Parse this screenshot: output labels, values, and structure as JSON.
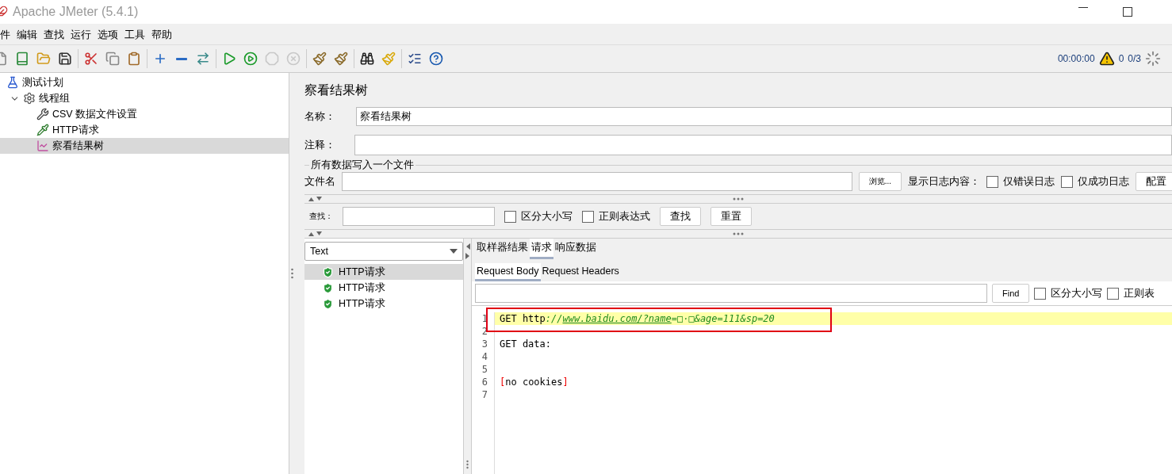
{
  "window": {
    "title": "Apache JMeter (5.4.1)"
  },
  "menu": [
    "件",
    "编辑",
    "查找",
    "运行",
    "选项",
    "工具",
    "帮助"
  ],
  "toolbar": [
    [
      {
        "kind": "new",
        "disabled": false
      },
      {
        "kind": "templates",
        "disabled": false
      },
      {
        "kind": "open",
        "disabled": false
      },
      {
        "kind": "save",
        "disabled": false
      }
    ],
    [
      {
        "kind": "cut",
        "disabled": false
      },
      {
        "kind": "copy",
        "disabled": false
      },
      {
        "kind": "paste",
        "disabled": false
      }
    ],
    [
      {
        "kind": "expand",
        "disabled": false
      },
      {
        "kind": "collapse",
        "disabled": false
      },
      {
        "kind": "toggle",
        "disabled": false
      }
    ],
    [
      {
        "kind": "start",
        "disabled": false
      },
      {
        "kind": "start-no-timers",
        "disabled": false
      },
      {
        "kind": "stop",
        "disabled": true
      },
      {
        "kind": "shutdown",
        "disabled": true
      }
    ],
    [
      {
        "kind": "clear",
        "disabled": false
      },
      {
        "kind": "clear-all",
        "disabled": false
      }
    ],
    [
      {
        "kind": "search",
        "disabled": false
      },
      {
        "kind": "reset-search",
        "disabled": false
      }
    ],
    [
      {
        "kind": "functions",
        "disabled": false
      },
      {
        "kind": "help",
        "disabled": false
      }
    ]
  ],
  "status": {
    "timer": "00:00:00",
    "warnings": "0",
    "threads": "0/3"
  },
  "tree": [
    {
      "label": "测试计划",
      "kind": "plan",
      "selected": false,
      "children": [
        {
          "label": "线程组",
          "kind": "thread-group",
          "selected": false,
          "expanded": true,
          "children": [
            {
              "label": "CSV 数据文件设置",
              "kind": "config",
              "selected": false
            },
            {
              "label": "HTTP请求",
              "kind": "sampler",
              "selected": false
            },
            {
              "label": "察看结果树",
              "kind": "listener",
              "selected": true
            }
          ]
        }
      ]
    }
  ],
  "panel": {
    "title": "察看结果树",
    "name": {
      "label": "名称：",
      "value": "察看结果树"
    },
    "comment": {
      "label": "注释："
    },
    "file_group": {
      "legend": "所有数据写入一个文件",
      "label": "文件名",
      "browse": "浏览...",
      "log_label": "显示日志内容：",
      "checkboxes": [
        {
          "label": "仅错误日志",
          "checked": false
        },
        {
          "label": "仅成功日志",
          "checked": false
        }
      ],
      "configure": "配置"
    },
    "search": {
      "label": "查找：",
      "checkboxes": [
        {
          "label": "区分大小写",
          "checked": false
        },
        {
          "label": "正则表达式",
          "checked": false
        }
      ],
      "buttons": [
        "查找",
        "重置"
      ]
    },
    "results": {
      "renderer": "Text",
      "items": [
        {
          "label": "HTTP请求",
          "selected": true
        },
        {
          "label": "HTTP请求",
          "selected": false
        },
        {
          "label": "HTTP请求",
          "selected": false
        }
      ],
      "tabs": [
        {
          "label": "取样器结果",
          "selected": false
        },
        {
          "label": "请求",
          "selected": true
        },
        {
          "label": "响应数据",
          "selected": false
        }
      ],
      "subtabs": [
        {
          "label": "Request Body",
          "selected": true
        },
        {
          "label": "Request Headers",
          "selected": false
        }
      ],
      "find": {
        "button": "Find",
        "checkboxes": [
          {
            "label": "区分大小写",
            "checked": false
          },
          {
            "label": "正则表",
            "checked": false
          }
        ]
      },
      "lines": [
        {
          "number": "1",
          "highlighted": true,
          "annotated": true,
          "segments": [
            {
              "text": "GET http",
              "kind": "plain"
            },
            {
              "text": "://",
              "kind": "param"
            },
            {
              "text": "www.baidu.com/?name",
              "kind": "link"
            },
            {
              "text": "=□·□&age=111&sp=20",
              "kind": "param"
            }
          ]
        },
        {
          "number": "2",
          "highlighted": false,
          "annotated": false
        },
        {
          "number": "3",
          "highlighted": false,
          "annotated": false,
          "segments": [
            {
              "text": "GET data:",
              "kind": "plain"
            }
          ]
        },
        {
          "number": "4",
          "highlighted": false,
          "annotated": false
        },
        {
          "number": "5",
          "highlighted": false,
          "annotated": false
        },
        {
          "number": "6",
          "highlighted": false,
          "annotated": false,
          "segments": [
            {
              "text": "[",
              "kind": "bracket"
            },
            {
              "text": "no cookies",
              "kind": "plain"
            },
            {
              "text": "]",
              "kind": "bracket"
            }
          ]
        },
        {
          "number": "7",
          "highlighted": false,
          "annotated": false
        }
      ]
    }
  }
}
